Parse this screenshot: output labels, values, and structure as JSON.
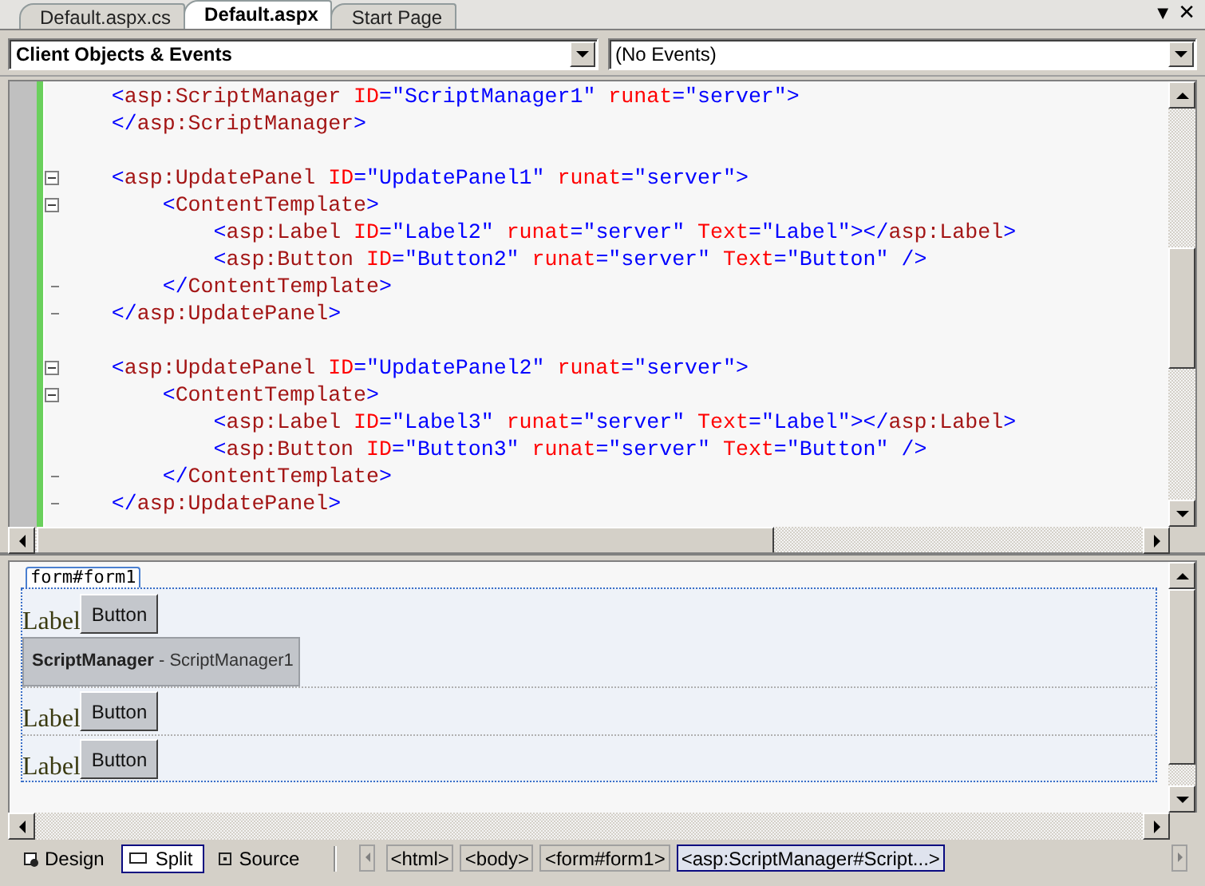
{
  "tabs": [
    {
      "label": "Default.aspx.cs",
      "selected": false
    },
    {
      "label": "Default.aspx",
      "selected": true
    },
    {
      "label": "Start Page",
      "selected": false
    }
  ],
  "tab_strip_glyphs": [
    {
      "kind": "menu",
      "text": "▼"
    },
    {
      "kind": "close",
      "text": "✕"
    }
  ],
  "object_dropdown": {
    "value": "Client Objects & Events"
  },
  "event_dropdown": {
    "value": "(No Events)"
  },
  "code_lines": [
    {
      "kind": "plain",
      "tokens": [
        {
          "kind": "punct",
          "text": "    <"
        },
        {
          "kind": "element",
          "text": "asp:ScriptManager"
        },
        {
          "kind": "attr",
          "text": " ID"
        },
        {
          "kind": "punct",
          "text": "="
        },
        {
          "kind": "value",
          "text": "\"ScriptManager1\""
        },
        {
          "kind": "attr",
          "text": " runat"
        },
        {
          "kind": "punct",
          "text": "="
        },
        {
          "kind": "value",
          "text": "\"server\""
        },
        {
          "kind": "punct",
          "text": ">"
        }
      ]
    },
    {
      "kind": "plain",
      "tokens": [
        {
          "kind": "punct",
          "text": "    </"
        },
        {
          "kind": "element",
          "text": "asp:ScriptManager"
        },
        {
          "kind": "punct",
          "text": ">"
        }
      ]
    },
    {
      "kind": "blank"
    },
    {
      "kind": "collapse",
      "tokens": [
        {
          "kind": "punct",
          "text": "    <"
        },
        {
          "kind": "element",
          "text": "asp:UpdatePanel"
        },
        {
          "kind": "attr",
          "text": " ID"
        },
        {
          "kind": "punct",
          "text": "="
        },
        {
          "kind": "value",
          "text": "\"UpdatePanel1\""
        },
        {
          "kind": "attr",
          "text": " runat"
        },
        {
          "kind": "punct",
          "text": "="
        },
        {
          "kind": "value",
          "text": "\"server\""
        },
        {
          "kind": "punct",
          "text": ">"
        }
      ]
    },
    {
      "kind": "collapse",
      "tokens": [
        {
          "kind": "punct",
          "text": "        <"
        },
        {
          "kind": "element",
          "text": "ContentTemplate"
        },
        {
          "kind": "punct",
          "text": ">"
        }
      ]
    },
    {
      "kind": "plain",
      "tokens": [
        {
          "kind": "punct",
          "text": "            <"
        },
        {
          "kind": "element",
          "text": "asp:Label"
        },
        {
          "kind": "attr",
          "text": " ID"
        },
        {
          "kind": "punct",
          "text": "="
        },
        {
          "kind": "value",
          "text": "\"Label2\""
        },
        {
          "kind": "attr",
          "text": " runat"
        },
        {
          "kind": "punct",
          "text": "="
        },
        {
          "kind": "value",
          "text": "\"server\""
        },
        {
          "kind": "attr",
          "text": " Text"
        },
        {
          "kind": "punct",
          "text": "="
        },
        {
          "kind": "value",
          "text": "\"Label\""
        },
        {
          "kind": "punct",
          "text": "></"
        },
        {
          "kind": "element",
          "text": "asp:Label"
        },
        {
          "kind": "punct",
          "text": ">"
        }
      ]
    },
    {
      "kind": "plain",
      "tokens": [
        {
          "kind": "punct",
          "text": "            <"
        },
        {
          "kind": "element",
          "text": "asp:Button"
        },
        {
          "kind": "attr",
          "text": " ID"
        },
        {
          "kind": "punct",
          "text": "="
        },
        {
          "kind": "value",
          "text": "\"Button2\""
        },
        {
          "kind": "attr",
          "text": " runat"
        },
        {
          "kind": "punct",
          "text": "="
        },
        {
          "kind": "value",
          "text": "\"server\""
        },
        {
          "kind": "attr",
          "text": " Text"
        },
        {
          "kind": "punct",
          "text": "="
        },
        {
          "kind": "value",
          "text": "\"Button\""
        },
        {
          "kind": "punct",
          "text": " />"
        }
      ]
    },
    {
      "kind": "end",
      "tokens": [
        {
          "kind": "punct",
          "text": "        </"
        },
        {
          "kind": "element",
          "text": "ContentTemplate"
        },
        {
          "kind": "punct",
          "text": ">"
        }
      ]
    },
    {
      "kind": "end",
      "tokens": [
        {
          "kind": "punct",
          "text": "    </"
        },
        {
          "kind": "element",
          "text": "asp:UpdatePanel"
        },
        {
          "kind": "punct",
          "text": ">"
        }
      ]
    },
    {
      "kind": "blank"
    },
    {
      "kind": "collapse",
      "tokens": [
        {
          "kind": "punct",
          "text": "    <"
        },
        {
          "kind": "element",
          "text": "asp:UpdatePanel"
        },
        {
          "kind": "attr",
          "text": " ID"
        },
        {
          "kind": "punct",
          "text": "="
        },
        {
          "kind": "value",
          "text": "\"UpdatePanel2\""
        },
        {
          "kind": "attr",
          "text": " runat"
        },
        {
          "kind": "punct",
          "text": "="
        },
        {
          "kind": "value",
          "text": "\"server\""
        },
        {
          "kind": "punct",
          "text": ">"
        }
      ]
    },
    {
      "kind": "collapse",
      "tokens": [
        {
          "kind": "punct",
          "text": "        <"
        },
        {
          "kind": "element",
          "text": "ContentTemplate"
        },
        {
          "kind": "punct",
          "text": ">"
        }
      ]
    },
    {
      "kind": "plain",
      "tokens": [
        {
          "kind": "punct",
          "text": "            <"
        },
        {
          "kind": "element",
          "text": "asp:Label"
        },
        {
          "kind": "attr",
          "text": " ID"
        },
        {
          "kind": "punct",
          "text": "="
        },
        {
          "kind": "value",
          "text": "\"Label3\""
        },
        {
          "kind": "attr",
          "text": " runat"
        },
        {
          "kind": "punct",
          "text": "="
        },
        {
          "kind": "value",
          "text": "\"server\""
        },
        {
          "kind": "attr",
          "text": " Text"
        },
        {
          "kind": "punct",
          "text": "="
        },
        {
          "kind": "value",
          "text": "\"Label\""
        },
        {
          "kind": "punct",
          "text": "></"
        },
        {
          "kind": "element",
          "text": "asp:Label"
        },
        {
          "kind": "punct",
          "text": ">"
        }
      ]
    },
    {
      "kind": "plain",
      "tokens": [
        {
          "kind": "punct",
          "text": "            <"
        },
        {
          "kind": "element",
          "text": "asp:Button"
        },
        {
          "kind": "attr",
          "text": " ID"
        },
        {
          "kind": "punct",
          "text": "="
        },
        {
          "kind": "value",
          "text": "\"Button3\""
        },
        {
          "kind": "attr",
          "text": " runat"
        },
        {
          "kind": "punct",
          "text": "="
        },
        {
          "kind": "value",
          "text": "\"server\""
        },
        {
          "kind": "attr",
          "text": " Text"
        },
        {
          "kind": "punct",
          "text": "="
        },
        {
          "kind": "value",
          "text": "\"Button\""
        },
        {
          "kind": "punct",
          "text": " />"
        }
      ]
    },
    {
      "kind": "end",
      "tokens": [
        {
          "kind": "punct",
          "text": "        </"
        },
        {
          "kind": "element",
          "text": "ContentTemplate"
        },
        {
          "kind": "punct",
          "text": ">"
        }
      ]
    },
    {
      "kind": "end",
      "tokens": [
        {
          "kind": "punct",
          "text": "    </"
        },
        {
          "kind": "element",
          "text": "asp:UpdatePanel"
        },
        {
          "kind": "punct",
          "text": ">"
        }
      ]
    }
  ],
  "design": {
    "form_tag": "form#form1",
    "items": [
      {
        "kind": "plain",
        "label": "Label",
        "button": "Button"
      },
      {
        "kind": "component",
        "text": "**ScriptManager** - ScriptManager1"
      },
      {
        "kind": "update-panel",
        "label": "Label",
        "button": "Button"
      },
      {
        "kind": "update-panel",
        "label": "Label",
        "button": "Button"
      }
    ]
  },
  "view_buttons": [
    {
      "kind": "design",
      "label": "Design",
      "selected": false
    },
    {
      "kind": "split",
      "label": "Split",
      "selected": true
    },
    {
      "kind": "source",
      "label": "Source",
      "selected": false
    }
  ],
  "breadcrumb": [
    {
      "label": "<html>",
      "selected": false
    },
    {
      "label": "<body>",
      "selected": false
    },
    {
      "label": "<form#form1>",
      "selected": false
    },
    {
      "label": "<asp:ScriptManager#Script...>",
      "selected": true
    }
  ]
}
